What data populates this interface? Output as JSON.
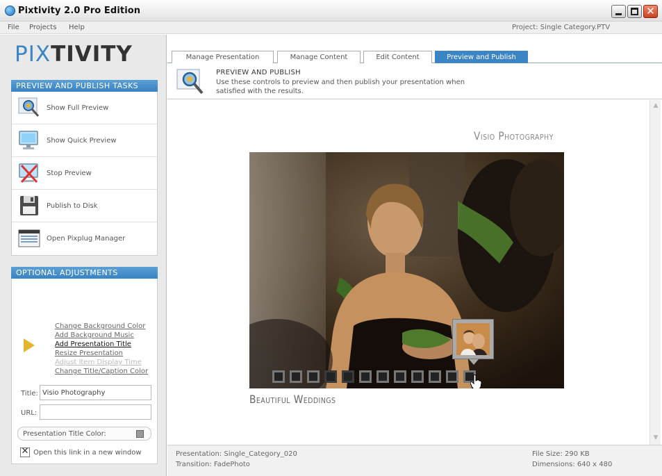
{
  "window": {
    "title": "Pixtivity 2.0 Pro Edition",
    "close_glyph": "✕"
  },
  "menu": {
    "file": "File",
    "projects": "Projects",
    "help": "Help",
    "project_label": "Project: Single Category.PTV"
  },
  "logo": {
    "part1": "PIX",
    "part2": "TIVITY"
  },
  "tasks": {
    "header": "PREVIEW AND PUBLISH TASKS",
    "items": [
      {
        "label": "Show Full Preview",
        "icon": "magnifier-icon"
      },
      {
        "label": "Show Quick Preview",
        "icon": "monitor-icon"
      },
      {
        "label": "Stop Preview",
        "icon": "stop-monitor-icon"
      },
      {
        "label": "Publish to Disk",
        "icon": "floppy-disk-icon"
      },
      {
        "label": "Open Pixplug Manager",
        "icon": "window-icon"
      }
    ]
  },
  "options": {
    "header": "OPTIONAL ADJUSTMENTS",
    "links": [
      {
        "label": "Change Background Color",
        "state": "normal"
      },
      {
        "label": "Add Background Music",
        "state": "normal"
      },
      {
        "label": "Add Presentation Title",
        "state": "active"
      },
      {
        "label": "Resize Presentation",
        "state": "normal"
      },
      {
        "label": "Adjust Item Display Time",
        "state": "disabled"
      },
      {
        "label": "Change Title/Caption Color",
        "state": "normal"
      }
    ],
    "title_label": "Title:",
    "title_value": "Visio Photography",
    "url_label": "URL:",
    "url_value": "",
    "color_label": "Presentation Title Color:",
    "color_value": "#9a9a9a",
    "checkbox_mark": "✕",
    "checkbox_label": "Open this link in a new window"
  },
  "tabs": [
    {
      "label": "Manage Presentation",
      "active": false
    },
    {
      "label": "Manage Content",
      "active": false
    },
    {
      "label": "Edit Content",
      "active": false
    },
    {
      "label": "Preview and Publish",
      "active": true
    }
  ],
  "header": {
    "title": "PREVIEW AND PUBLISH",
    "description": "Use these controls to preview and then publish your presentation when satisfied with the results."
  },
  "preview": {
    "title": "Visio Photography",
    "caption": "Beautiful Weddings",
    "thumbnail_count": 12,
    "highlighted_thumbnail": 12
  },
  "status": {
    "presentation": "Presentation: Single_Category_020",
    "transition": "Transition: FadePhoto",
    "file_size": "File Size: 290 KB",
    "dimensions": "Dimensions: 640 x 480"
  },
  "colors": {
    "accent": "#3c85c4",
    "tab_active": "#3c85c4",
    "arrow": "#e3b52a"
  }
}
